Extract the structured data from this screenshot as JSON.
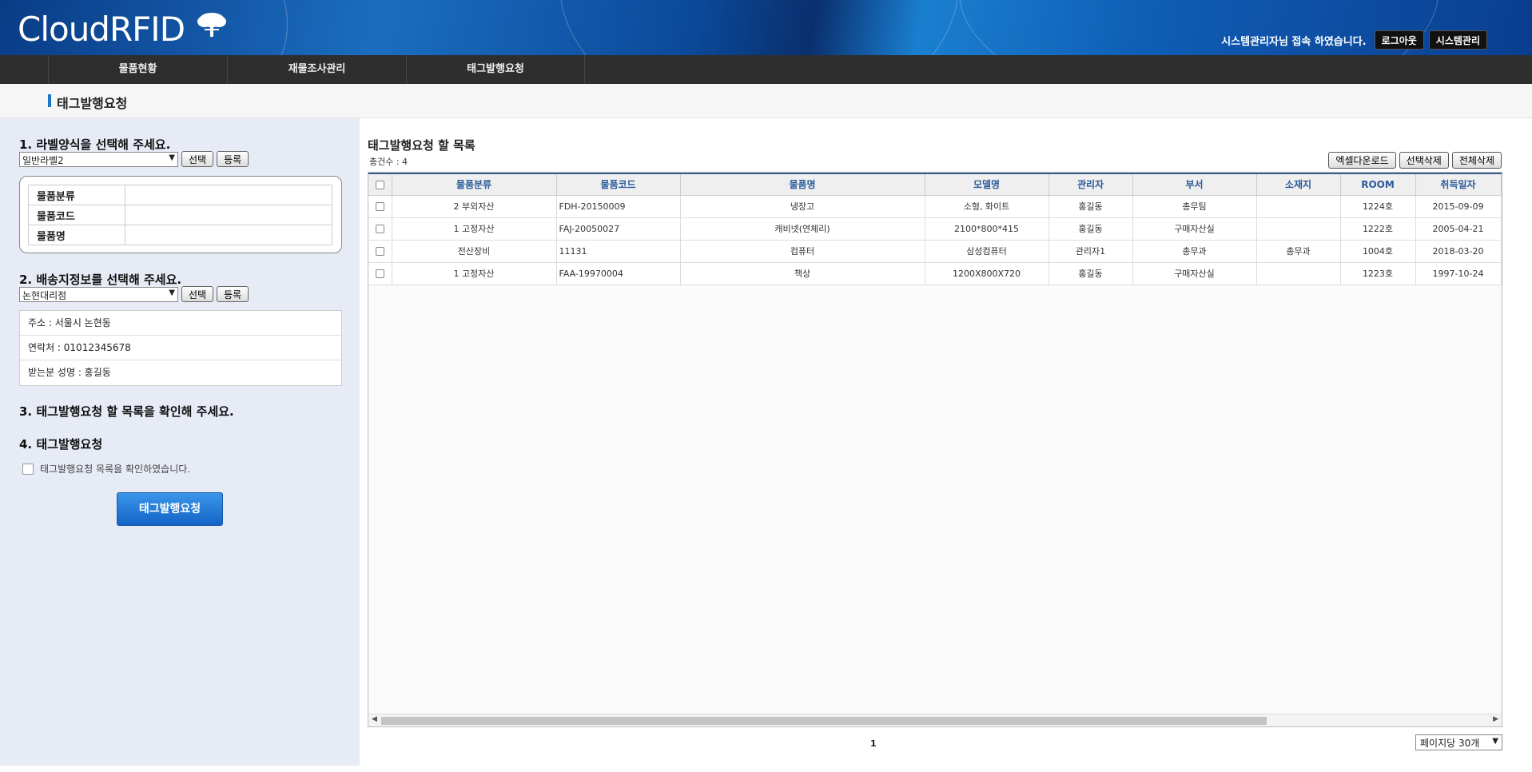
{
  "header": {
    "logo": "CloudRFID",
    "welcome": "시스템관리자님 접속 하였습니다.",
    "logout_label": "로그아웃",
    "admin_label": "시스템관리"
  },
  "nav": {
    "items": [
      "물품현황",
      "재물조사관리",
      "태그발행요청"
    ]
  },
  "page": {
    "title": "태그발행요청"
  },
  "left": {
    "step1": "1. 라벨양식을 선택해 주세요.",
    "label_select": "일반라벨2",
    "select_label": "선택",
    "register_label": "등록",
    "label_fields": [
      {
        "key": "물품분류",
        "value": ""
      },
      {
        "key": "물품코드",
        "value": ""
      },
      {
        "key": "물품명",
        "value": ""
      }
    ],
    "step2": "2. 배송지정보를 선택해 주세요.",
    "shipping_select": "논현대리점",
    "address": "주소 : 서울시 논현동",
    "phone": "연락처 : 01012345678",
    "recipient": "받는분 성명 : 홍길동",
    "step3": "3. 태그발행요청 할 목록을 확인해 주세요.",
    "step4": "4. 태그발행요청",
    "confirm_text": "태그발행요청 목록을 확인하였습니다.",
    "submit_label": "태그발행요청"
  },
  "list": {
    "title": "태그발행요청 할 목록",
    "count": "총건수 : 4",
    "excel_label": "엑셀다운로드",
    "delete_selected_label": "선택삭제",
    "delete_all_label": "전체삭제",
    "columns": [
      "물품분류",
      "물품코드",
      "물품명",
      "모델명",
      "관리자",
      "부서",
      "소재지",
      "ROOM",
      "취득일자"
    ],
    "rows": [
      [
        "2 부외자산",
        "FDH-20150009",
        "냉장고",
        "소형, 화이트",
        "홍길동",
        "총무팀",
        "",
        "1224호",
        "2015-09-09"
      ],
      [
        "1 고정자산",
        "FAJ-20050027",
        "캐비넷(연체리)",
        "2100*800*415",
        "홍길동",
        "구매자산실",
        "",
        "1222호",
        "2005-04-21"
      ],
      [
        "전산장비",
        "11131",
        "컴퓨터",
        "삼성컴퓨터",
        "관리자1",
        "총무과",
        "총무과",
        "1004호",
        "2018-03-20"
      ],
      [
        "1 고정자산",
        "FAA-19970004",
        "책상",
        "1200X800X720",
        "홍길동",
        "구매자산실",
        "",
        "1223호",
        "1997-10-24"
      ]
    ],
    "page": "1",
    "per_page": "페이지당 30개"
  }
}
